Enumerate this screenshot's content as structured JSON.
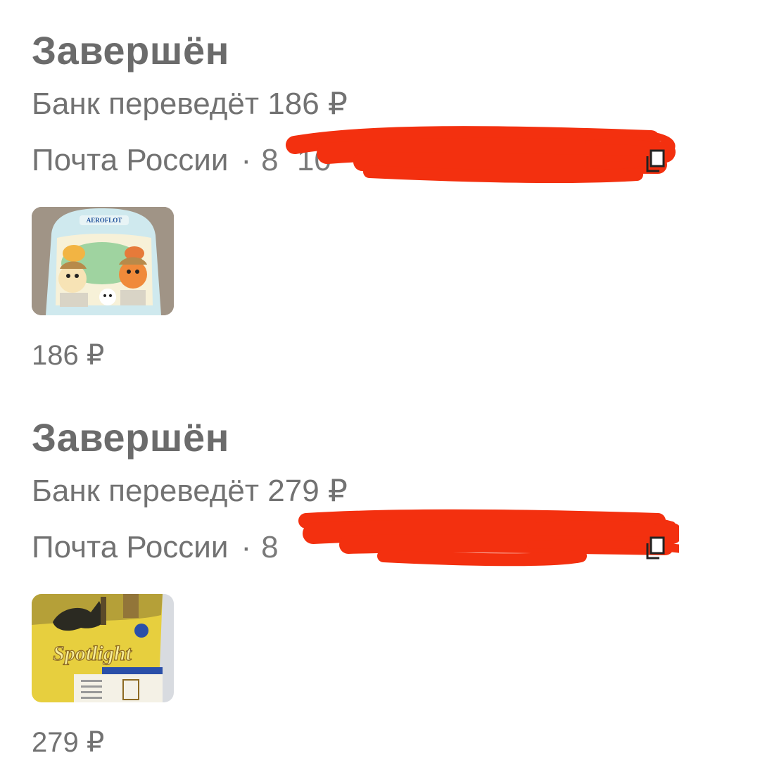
{
  "orders": [
    {
      "status": "Завершён",
      "refund_text": "Банк переведёт 186 ₽",
      "carrier": "Почта России",
      "separator": "·",
      "tracking": "8   10                      26",
      "copy_icon": "copy-icon",
      "thumbnail": "backpack-product-image",
      "thumbnail_text": "AEROFLOT",
      "price": "186 ₽"
    },
    {
      "status": "Завершён",
      "refund_text": "Банк переведёт 279 ₽",
      "carrier": "Почта России",
      "separator": "·",
      "tracking": "8",
      "copy_icon": "copy-icon",
      "thumbnail": "textbook-product-image",
      "thumbnail_text": "Spotlight",
      "price": "279 ₽"
    }
  ],
  "colors": {
    "text": "#727272",
    "heading": "#6b6b6b",
    "redaction": "#f3300f"
  }
}
